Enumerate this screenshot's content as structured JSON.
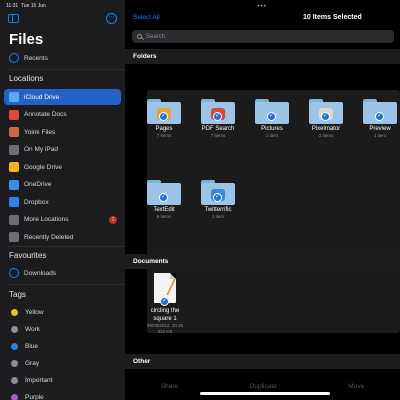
{
  "status": {
    "time": "11:31",
    "date": "Tue 15 Jun"
  },
  "sidebar": {
    "title": "Files",
    "recents": "Recents",
    "locations_header": "Locations",
    "locations": [
      {
        "label": "iCloud Drive",
        "icon": "icloud-icon",
        "color": "#5aa8f2"
      },
      {
        "label": "Annotate Docs",
        "icon": "annotate-icon",
        "color": "#d94a3b"
      },
      {
        "label": "Yoink Files",
        "icon": "yoink-icon",
        "color": "#c86a3a"
      },
      {
        "label": "On My iPad",
        "icon": "ipad-icon",
        "color": "#6e6e73"
      },
      {
        "label": "Google Drive",
        "icon": "google-drive-icon",
        "color": "#f2b21b"
      },
      {
        "label": "OneDrive",
        "icon": "onedrive-icon",
        "color": "#3c8be8"
      },
      {
        "label": "Dropbox",
        "icon": "dropbox-icon",
        "color": "#2f80ed"
      },
      {
        "label": "More Locations",
        "icon": "more-locations-icon",
        "color": "#6e6e73",
        "badge": "1"
      },
      {
        "label": "Recently Deleted",
        "icon": "trash-icon",
        "color": "#6e6e73"
      }
    ],
    "favourites_header": "Favourites",
    "favourites": [
      {
        "label": "Downloads",
        "icon": "downloads-icon"
      }
    ],
    "tags_header": "Tags",
    "tags": [
      {
        "label": "Yellow",
        "color": "#e6c229"
      },
      {
        "label": "Work",
        "color": "#8e8e93"
      },
      {
        "label": "Blue",
        "color": "#2f7de1"
      },
      {
        "label": "Gray",
        "color": "#8e8e93"
      },
      {
        "label": "Important",
        "color": "#8e8e93"
      },
      {
        "label": "Purple",
        "color": "#a65bd0"
      }
    ]
  },
  "main": {
    "select_all": "Select All",
    "items_selected": "10 Items Selected",
    "search_placeholder": "Search",
    "folders_header": "Folders",
    "folders": [
      {
        "name": "Pages",
        "count": "7 items",
        "emblem": "pages-icon",
        "emblem_color": "#e8a33a"
      },
      {
        "name": "PDF Search",
        "count": "7 items",
        "emblem": "pdf-search-icon",
        "emblem_color": "#d9473d"
      },
      {
        "name": "Pictures",
        "count": "1 item",
        "emblem": "",
        "emblem_color": ""
      },
      {
        "name": "Pixelmator",
        "count": "3 items",
        "emblem": "pixelmator-icon",
        "emblem_color": "#d8d8d8"
      },
      {
        "name": "Preview",
        "count": "1 item",
        "emblem": "",
        "emblem_color": ""
      },
      {
        "name": "TextEdit",
        "count": "6 items",
        "emblem": "",
        "emblem_color": ""
      },
      {
        "name": "Twitterrific",
        "count": "1 item",
        "emblem": "twitterrific-icon",
        "emblem_color": "#3a8ad8"
      }
    ],
    "documents_header": "Documents",
    "document": {
      "name_line1": "circling the",
      "name_line2": "square 1",
      "date": "09/05/2012, 20:45",
      "size": "534 KB"
    },
    "other_header": "Other",
    "toolbar": {
      "share": "Share",
      "duplicate": "Duplicate",
      "move": "Move"
    }
  }
}
